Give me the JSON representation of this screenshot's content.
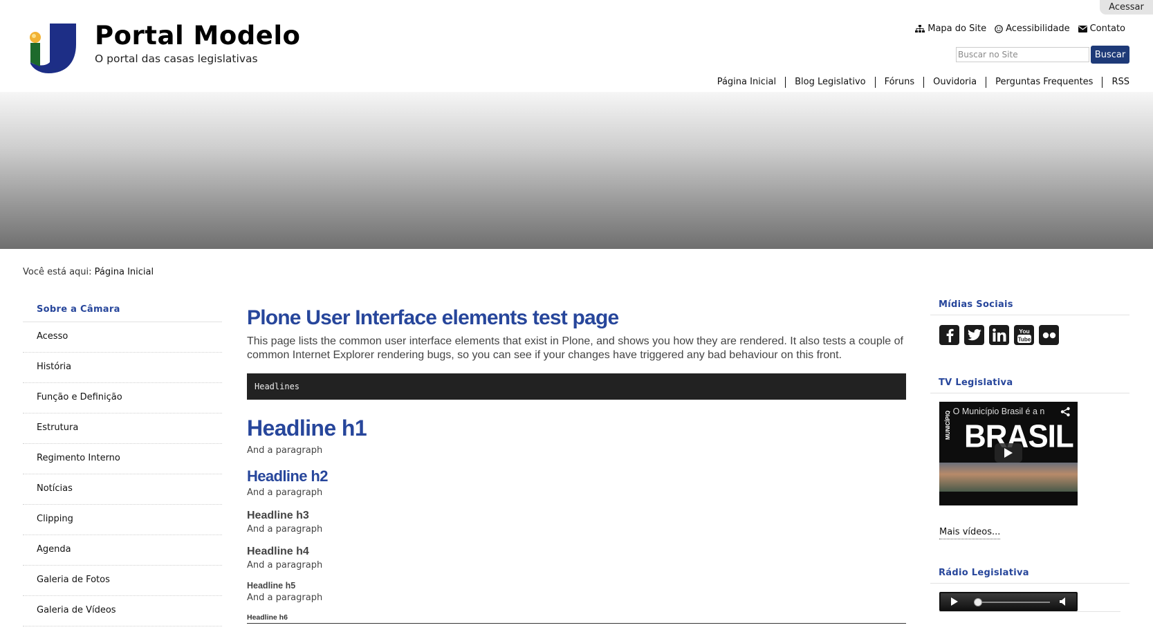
{
  "header": {
    "login_label": "Acessar",
    "site_title": "Portal Modelo",
    "site_tagline": "O portal das casas legislativas",
    "site_actions": [
      {
        "label": "Mapa do Site",
        "icon": "sitemap-icon"
      },
      {
        "label": "Acessibilidade",
        "icon": "accessibility-icon"
      },
      {
        "label": "Contato",
        "icon": "envelope-icon"
      }
    ],
    "search": {
      "placeholder": "Buscar no Site",
      "button_label": "Buscar"
    },
    "nav": [
      "Página Inicial",
      "Blog Legislativo",
      "Fóruns",
      "Ouvidoria",
      "Perguntas Frequentes",
      "RSS"
    ]
  },
  "breadcrumb": {
    "prefix": "Você está aqui:",
    "current": "Página Inicial"
  },
  "left_portlet": {
    "header": "Sobre a Câmara",
    "items": [
      "Acesso",
      "História",
      "Função e Definição",
      "Estrutura",
      "Regimento Interno",
      "Notícias",
      "Clipping",
      "Agenda",
      "Galeria de Fotos",
      "Galeria de Vídeos"
    ]
  },
  "content": {
    "title": "Plone User Interface elements test page",
    "description": "This page lists the common user interface elements that exist in Plone, and shows you how they are rendered. It also tests a couple of common Internet Explorer rendering bugs, so you can see if your changes have triggered any bad behaviour on this front.",
    "code_bar": "Headlines",
    "headlines": {
      "h1": "Headline h1",
      "h2": "Headline h2",
      "h3": "Headline h3",
      "h4": "Headline h4",
      "h5": "Headline h5",
      "h6": "Headline h6"
    },
    "paragraph": "And a paragraph"
  },
  "right_column": {
    "social_header": "Mídias Sociais",
    "social_icons": [
      "facebook-icon",
      "twitter-icon",
      "linkedin-icon",
      "youtube-icon",
      "flickr-icon"
    ],
    "tv_header": "TV Legislativa",
    "video": {
      "title": "- O Município Brasil é a n",
      "brand_text": "BRASIL",
      "brand_small": "MUNICÍPIO"
    },
    "more_videos": "Mais vídeos...",
    "radio_header": "Rádio Legislativa"
  },
  "colors": {
    "accent": "#27469b",
    "button": "#1e3a78",
    "code_bar": "#222222"
  }
}
